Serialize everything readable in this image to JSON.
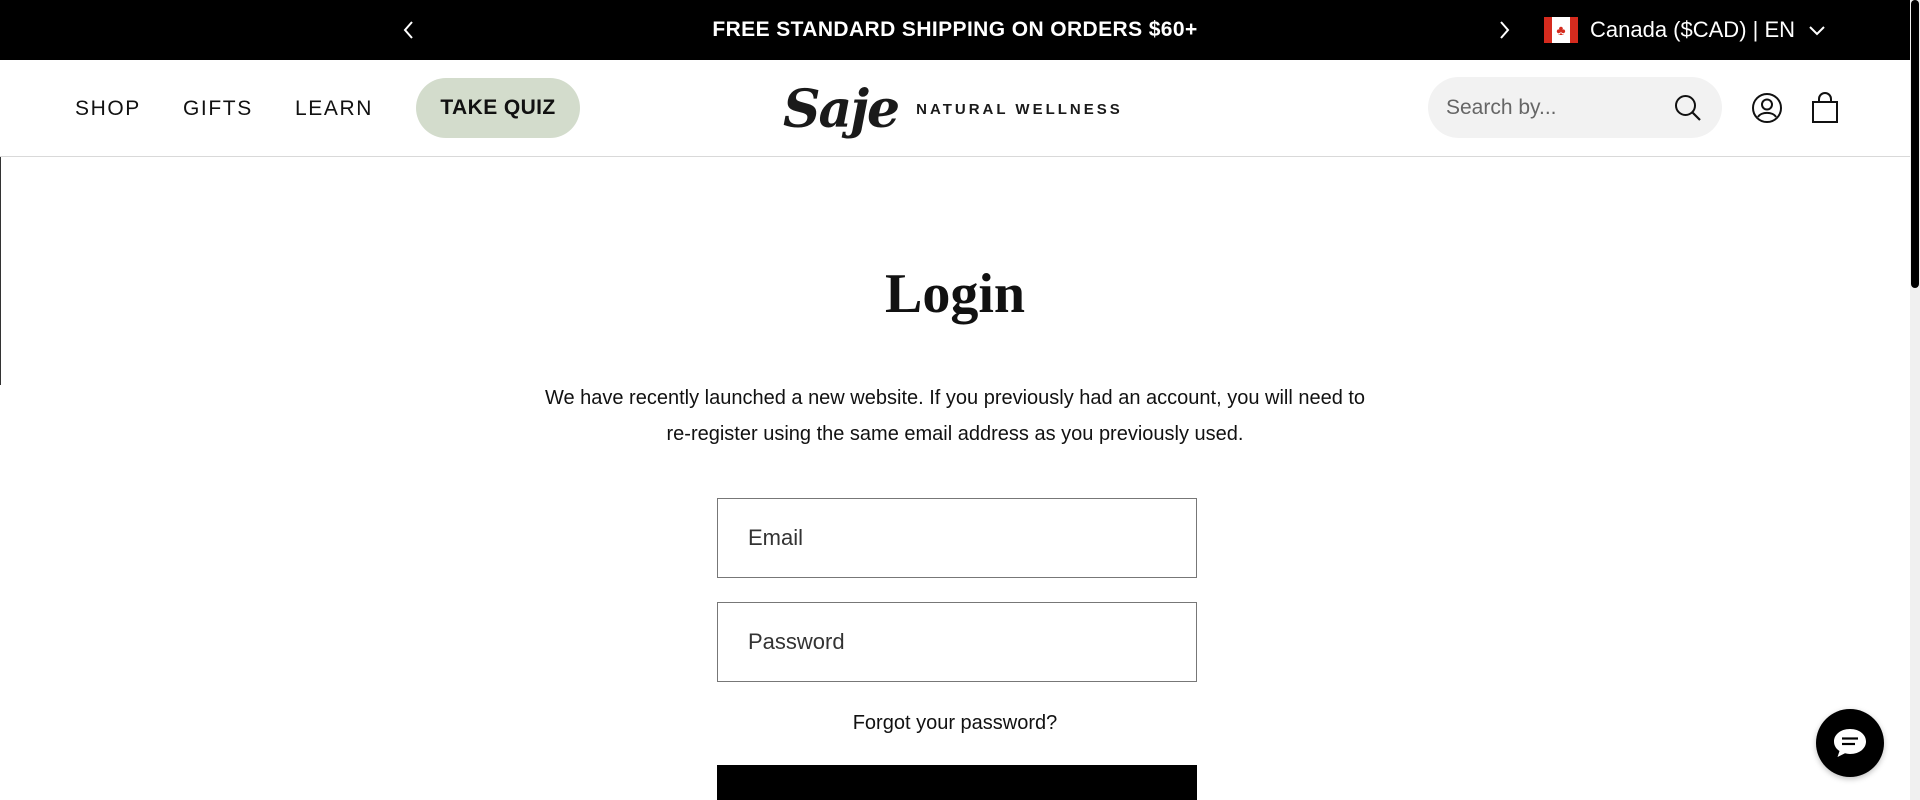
{
  "announcement": {
    "message": "FREE STANDARD SHIPPING ON ORDERS $60+",
    "locale": "Canada ($CAD) | EN",
    "prev_icon": "chevron-left-icon",
    "next_icon": "chevron-right-icon",
    "flag_icon": "canada-flag-icon"
  },
  "header": {
    "nav": [
      {
        "label": "SHOP"
      },
      {
        "label": "GIFTS"
      },
      {
        "label": "LEARN"
      }
    ],
    "quiz_label": "TAKE QUIZ",
    "quiz_color": "#d3dccc",
    "logo": {
      "script": "Saje",
      "tagline": "NATURAL WELLNESS"
    },
    "search": {
      "placeholder": "Search by...",
      "icon": "search-icon"
    },
    "account_icon": "account-icon",
    "cart_icon": "cart-icon"
  },
  "main": {
    "title": "Login",
    "intro": "We have recently launched a new website. If you previously had an account, you will need to re-register using the same email address as you previously used.",
    "email_placeholder": "Email",
    "password_placeholder": "Password",
    "forgot_label": "Forgot your password?"
  },
  "chat": {
    "icon": "chat-icon"
  }
}
